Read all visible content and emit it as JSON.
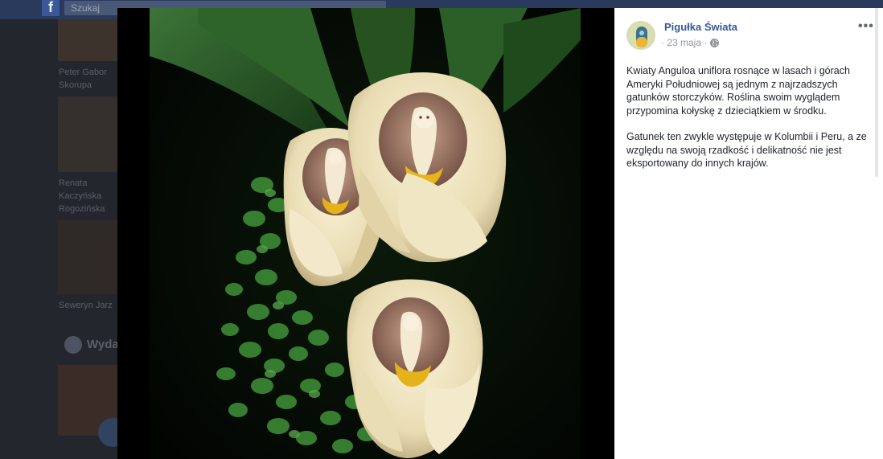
{
  "background": {
    "search_placeholder": "Szukaj",
    "fb_logo": "f",
    "friend_names": [
      "Peter Gabor Skorupa",
      "Renata Kaczyńska Rogozińska",
      "Seweryn Jarz"
    ],
    "section_label": "Wyda"
  },
  "post": {
    "page_name": "Pigułka Świata",
    "date": "· 23 maja ·",
    "privacy_icon": "globe-icon",
    "more_label": "•••",
    "paragraphs": [
      "Kwiaty Anguloa uniflora rosnące w lasach i górach Ameryki Południowej są jednym z najrzadszych gatunków storczyków. Roślina swoim wyglądem przypomina kołyskę z dzieciątkiem w środku.",
      "Gatunek ten zwykle występuje w Kolumbii i Peru, a ze względu na swoją rzadkość i delikatność nie jest eksportowany do innych krajów."
    ]
  },
  "colors": {
    "link_blue": "#365899",
    "text_dark": "#1d2129",
    "meta_gray": "#90949c",
    "flower_cream": "#efe6c6",
    "leaf_green": "#2f6a2c"
  }
}
